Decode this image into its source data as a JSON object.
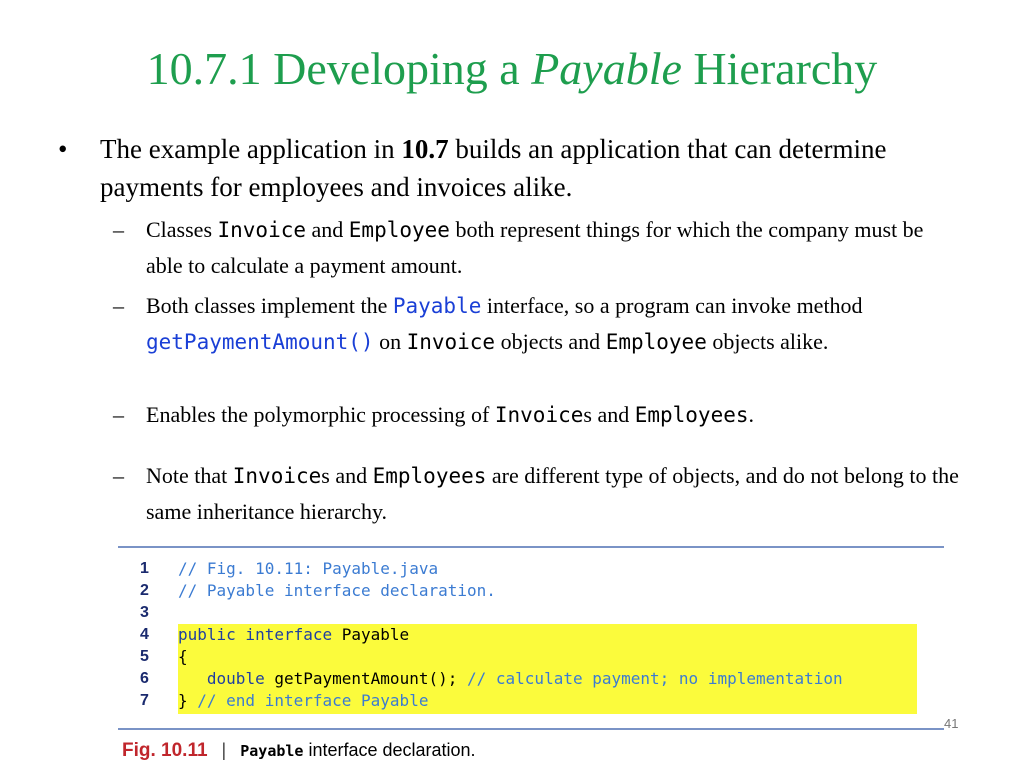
{
  "title": {
    "pre": "10.7.1 Developing a ",
    "italic": "Payable",
    "post": " Hierarchy"
  },
  "bullet": {
    "marker": "•",
    "t1": "The example application in ",
    "t2": "10.7",
    "t3": " builds an application that can determine payments for employees and invoices alike."
  },
  "subs": {
    "dash": "–",
    "s1": {
      "a": "Classes ",
      "b": "Invoice",
      "c": " and ",
      "d": "Employee",
      "e": " both represent things for which the company must be able to calculate a payment amount."
    },
    "s2": {
      "a": "Both classes implement the ",
      "b": "Payable",
      "c": " interface, so a program can invoke method ",
      "d": "getPaymentAmount()",
      "e": " on ",
      "f": "Invoice",
      "g": " objects and ",
      "h": "Employee",
      "i": " objects alike."
    },
    "s3": {
      "a": "Enables the polymorphic processing of ",
      "b": "Invoice",
      "c": "s and ",
      "d": "Employees",
      "e": "."
    },
    "s4": {
      "a": "Note that ",
      "b": "Invoice",
      "c": "s and ",
      "d": "Employees",
      "e": " are different type of objects, and do not belong to the same inheritance hierarchy."
    }
  },
  "code": {
    "lines": [
      {
        "n": "1",
        "comment": "// Fig. 10.11: Payable.java"
      },
      {
        "n": "2",
        "comment": "// Payable interface declaration."
      },
      {
        "n": "3"
      },
      {
        "n": "4",
        "kw": "public interface",
        "rest": " Payable"
      },
      {
        "n": "5",
        "rest": "{"
      },
      {
        "n": "6",
        "kw": "double",
        "rest": " getPaymentAmount(); ",
        "comment": "// calculate payment; no implementation"
      },
      {
        "n": "7",
        "rest": "} ",
        "comment": "// end interface Payable"
      }
    ]
  },
  "caption": {
    "fig": "Fig. 10.11",
    "sep": "|",
    "mono": "Payable",
    "text": " interface declaration."
  },
  "page_number": "41"
}
